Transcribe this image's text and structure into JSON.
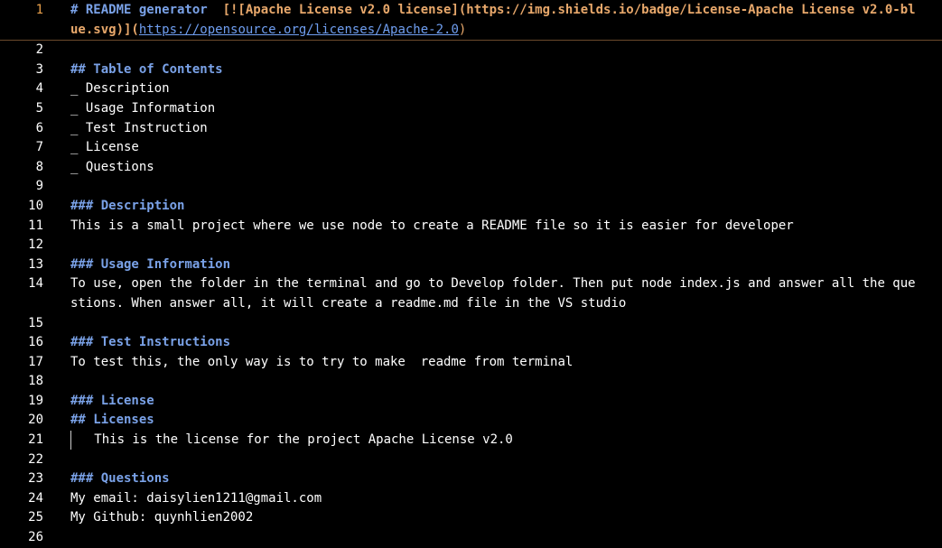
{
  "editor": {
    "active_line": 1,
    "lines": [
      {
        "num": "1",
        "segments": [
          {
            "text": "# README generator  ",
            "kind": "heading"
          },
          {
            "text": "[![Apache License v2.0 license](",
            "kind": "bracket"
          },
          {
            "text": "https://img.shields.io/badge/License-Apache License v2.0-blue.svg",
            "kind": "linkurl-bold"
          },
          {
            "text": ")](",
            "kind": "bracket"
          },
          {
            "text": "https://opensource.org/licenses/Apache-2.0",
            "kind": "url"
          },
          {
            "text": ")",
            "kind": "paren"
          }
        ]
      },
      {
        "num": "2",
        "segments": []
      },
      {
        "num": "3",
        "segments": [
          {
            "text": "## Table of Contents",
            "kind": "heading"
          }
        ]
      },
      {
        "num": "4",
        "segments": [
          {
            "text": "_ Description",
            "kind": "plain"
          }
        ]
      },
      {
        "num": "5",
        "segments": [
          {
            "text": "_ Usage Information",
            "kind": "plain"
          }
        ]
      },
      {
        "num": "6",
        "segments": [
          {
            "text": "_ Test Instruction",
            "kind": "plain"
          }
        ]
      },
      {
        "num": "7",
        "segments": [
          {
            "text": "_ License",
            "kind": "plain"
          }
        ]
      },
      {
        "num": "8",
        "segments": [
          {
            "text": "_ Questions",
            "kind": "plain"
          }
        ]
      },
      {
        "num": "9",
        "segments": []
      },
      {
        "num": "10",
        "segments": [
          {
            "text": "### Description",
            "kind": "heading"
          }
        ]
      },
      {
        "num": "11",
        "segments": [
          {
            "text": "This is a small project where we use node to create a README file so it is easier for developer",
            "kind": "plain"
          }
        ]
      },
      {
        "num": "12",
        "segments": []
      },
      {
        "num": "13",
        "segments": [
          {
            "text": "### Usage Information",
            "kind": "heading"
          }
        ]
      },
      {
        "num": "14",
        "segments": [
          {
            "text": "To use, open the folder in the terminal and go to Develop folder. Then put node index.js and answer all the questions. When answer all, it will create a readme.md file in the VS studio",
            "kind": "plain"
          }
        ]
      },
      {
        "num": "15",
        "segments": []
      },
      {
        "num": "16",
        "segments": [
          {
            "text": "### Test Instructions",
            "kind": "heading"
          }
        ]
      },
      {
        "num": "17",
        "segments": [
          {
            "text": "To test this, the only way is to try to make  readme from terminal",
            "kind": "plain"
          }
        ]
      },
      {
        "num": "18",
        "segments": []
      },
      {
        "num": "19",
        "segments": [
          {
            "text": "### License",
            "kind": "heading"
          }
        ]
      },
      {
        "num": "20",
        "segments": [
          {
            "text": "## Licenses",
            "kind": "heading"
          }
        ]
      },
      {
        "num": "21",
        "segments": [
          {
            "text": "    This is the license for the project Apache License v2.0",
            "kind": "indented"
          }
        ]
      },
      {
        "num": "22",
        "segments": []
      },
      {
        "num": "23",
        "segments": [
          {
            "text": "### Questions",
            "kind": "heading"
          }
        ]
      },
      {
        "num": "24",
        "segments": [
          {
            "text": "My email: daisylien1211@gmail.com",
            "kind": "plain"
          }
        ]
      },
      {
        "num": "25",
        "segments": [
          {
            "text": "My Github: quynhlien2002",
            "kind": "plain"
          }
        ]
      },
      {
        "num": "26",
        "segments": []
      }
    ]
  },
  "colors": {
    "background": "#000000",
    "heading": "#7aa2e8",
    "link_bracket": "#e8a86b",
    "url": "#6f9ef0",
    "active_line_number": "#e8a04b"
  }
}
